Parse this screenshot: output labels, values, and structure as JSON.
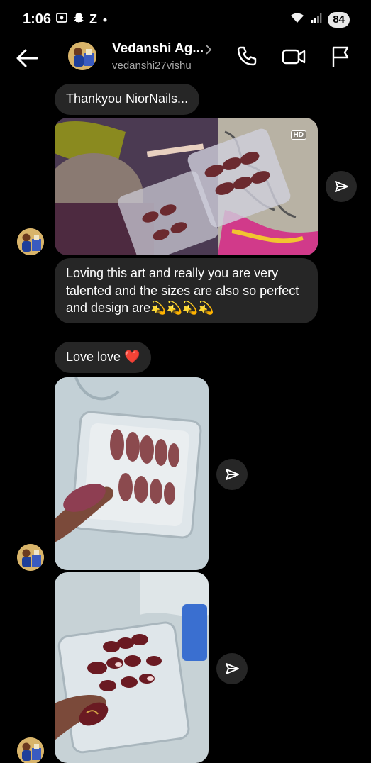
{
  "status": {
    "time": "1:06",
    "notif_icons": [
      "screen-record-icon",
      "snapchat-icon",
      "z-icon",
      "dot-icon"
    ],
    "z_label": "Z",
    "battery": "84"
  },
  "header": {
    "name": "Vedanshi Ag...",
    "username": "vedanshi27vishu"
  },
  "messages": [
    {
      "type": "text",
      "text": "Thankyou NiorNails..."
    },
    {
      "type": "image",
      "badge": "HD",
      "description": "press-on nails in case"
    },
    {
      "type": "text",
      "text": "Loving this art and really you are very talented and the sizes are also so perfect and design are💫💫💫💫"
    },
    {
      "type": "text",
      "text": "Love love ❤️"
    },
    {
      "type": "image",
      "description": "mauve nails in case"
    },
    {
      "type": "image",
      "description": "burgundy design nails in case"
    }
  ],
  "colors": {
    "background": "#000000",
    "bubble": "#262626",
    "muted_text": "#a8a8a8"
  }
}
